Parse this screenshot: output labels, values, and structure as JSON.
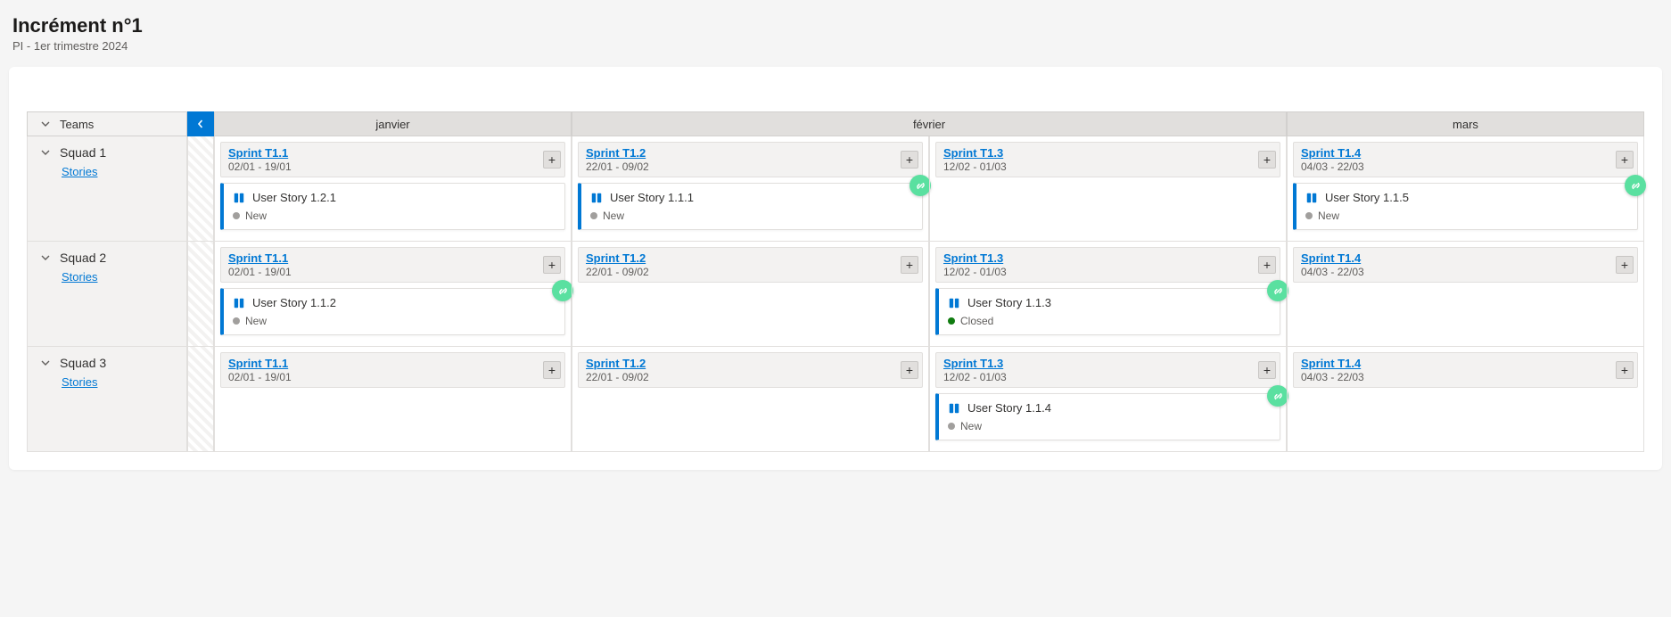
{
  "header": {
    "title": "Incrément n°1",
    "subtitle": "PI - 1er trimestre 2024"
  },
  "columns": {
    "teams_label": "Teams",
    "months": [
      "janvier",
      "février",
      "mars"
    ]
  },
  "squads": [
    {
      "name": "Squad 1",
      "stories_label": "Stories",
      "sprints": [
        {
          "name": "Sprint T1.1",
          "dates": "02/01 - 19/01",
          "stories": [
            {
              "title": "User Story 1.2.1",
              "status": "New",
              "status_color": "grey",
              "linked": false
            }
          ]
        },
        {
          "name": "Sprint T1.2",
          "dates": "22/01 - 09/02",
          "stories": [
            {
              "title": "User Story 1.1.1",
              "status": "New",
              "status_color": "grey",
              "linked": true
            }
          ]
        },
        {
          "name": "Sprint T1.3",
          "dates": "12/02 - 01/03",
          "stories": []
        },
        {
          "name": "Sprint T1.4",
          "dates": "04/03 - 22/03",
          "stories": [
            {
              "title": "User Story 1.1.5",
              "status": "New",
              "status_color": "grey",
              "linked": true
            }
          ]
        }
      ]
    },
    {
      "name": "Squad 2",
      "stories_label": "Stories",
      "sprints": [
        {
          "name": "Sprint T1.1",
          "dates": "02/01 - 19/01",
          "stories": [
            {
              "title": "User Story 1.1.2",
              "status": "New",
              "status_color": "grey",
              "linked": true
            }
          ]
        },
        {
          "name": "Sprint T1.2",
          "dates": "22/01 - 09/02",
          "stories": []
        },
        {
          "name": "Sprint T1.3",
          "dates": "12/02 - 01/03",
          "stories": [
            {
              "title": "User Story 1.1.3",
              "status": "Closed",
              "status_color": "green",
              "linked": true
            }
          ]
        },
        {
          "name": "Sprint T1.4",
          "dates": "04/03 - 22/03",
          "stories": []
        }
      ]
    },
    {
      "name": "Squad 3",
      "stories_label": "Stories",
      "sprints": [
        {
          "name": "Sprint T1.1",
          "dates": "02/01 - 19/01",
          "stories": []
        },
        {
          "name": "Sprint T1.2",
          "dates": "22/01 - 09/02",
          "stories": []
        },
        {
          "name": "Sprint T1.3",
          "dates": "12/02 - 01/03",
          "stories": [
            {
              "title": "User Story 1.1.4",
              "status": "New",
              "status_color": "grey",
              "linked": true
            }
          ]
        },
        {
          "name": "Sprint T1.4",
          "dates": "04/03 - 22/03",
          "stories": []
        }
      ]
    }
  ]
}
